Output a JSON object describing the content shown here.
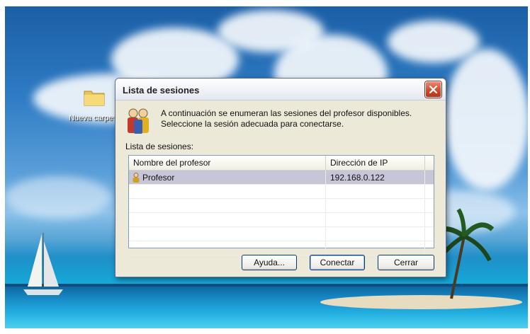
{
  "desktop": {
    "folder_label": "Nueva carpeta"
  },
  "dialog": {
    "title": "Lista de sesiones",
    "message_line1": "A continuación se enumeran las sesiones del profesor disponibles.",
    "message_line2": "Seleccione la sesión adecuada para conectarse.",
    "list_label": "Lista de sesiones:",
    "columns": [
      "Nombre del profesor",
      "Dirección de IP"
    ],
    "rows": [
      {
        "name": "Profesor",
        "ip": "192.168.0.122",
        "selected": true
      }
    ],
    "buttons": {
      "help": "Ayuda...",
      "connect": "Conectar",
      "close": "Cerrar"
    }
  },
  "colors": {
    "close_button": "#d14a2c",
    "selected_row": "#c7c5d8",
    "dialog_bg": "#ece9d8"
  },
  "icons": [
    "folder-icon",
    "users-icon",
    "user-icon",
    "close-icon"
  ]
}
